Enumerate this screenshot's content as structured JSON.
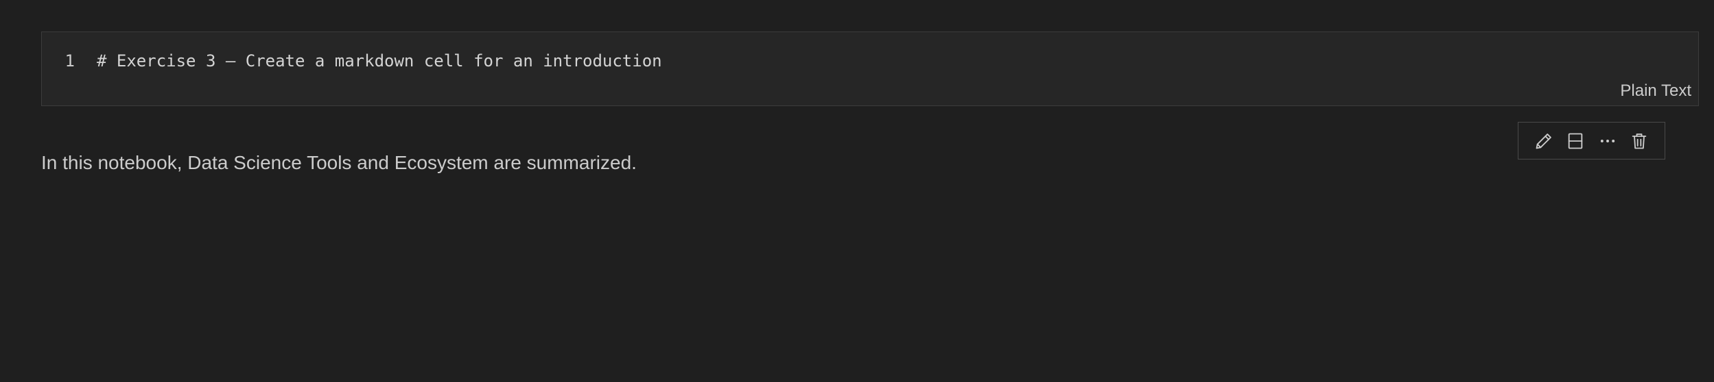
{
  "editor_cell": {
    "line_number": "1",
    "code": "# Exercise 3 – Create a markdown cell for an introduction",
    "language": "Plain Text"
  },
  "cell_toolbar": {
    "buttons": [
      {
        "icon": "pencil-icon"
      },
      {
        "icon": "split-cell-icon"
      },
      {
        "icon": "more-actions-icon"
      },
      {
        "icon": "trash-icon"
      }
    ]
  },
  "markdown_output": {
    "text": "In this notebook, Data Science Tools and Ecosystem are summarized."
  },
  "colors": {
    "background": "#1f1f1f",
    "cell_background": "#262626",
    "border": "#3c3c3c",
    "text": "#cccccc"
  }
}
